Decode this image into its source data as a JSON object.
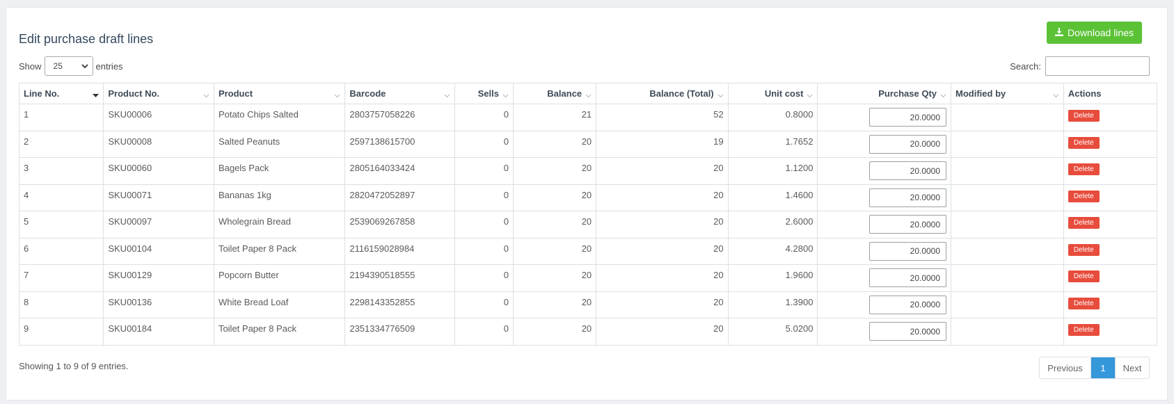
{
  "title": "Edit purchase draft lines",
  "download_button": "Download lines",
  "show_label": "Show",
  "entries_value": "25",
  "entries_label": "entries",
  "search_label": "Search:",
  "search_value": "",
  "columns": [
    "Line No.",
    "Product No.",
    "Product",
    "Barcode",
    "Sells",
    "Balance",
    "Balance (Total)",
    "Unit cost",
    "Purchase Qty",
    "Modified by",
    "Actions"
  ],
  "rows": [
    {
      "line": "1",
      "sku": "SKU00006",
      "product": "Potato Chips Salted",
      "barcode": "2803757058226",
      "sells": "0",
      "balance": "21",
      "balance_total": "52",
      "unit_cost": "0.8000",
      "qty": "20.0000",
      "modified_by": "",
      "action": "Delete"
    },
    {
      "line": "2",
      "sku": "SKU00008",
      "product": "Salted Peanuts",
      "barcode": "2597138615700",
      "sells": "0",
      "balance": "20",
      "balance_total": "19",
      "unit_cost": "1.7652",
      "qty": "20.0000",
      "modified_by": "",
      "action": "Delete"
    },
    {
      "line": "3",
      "sku": "SKU00060",
      "product": "Bagels Pack",
      "barcode": "2805164033424",
      "sells": "0",
      "balance": "20",
      "balance_total": "20",
      "unit_cost": "1.1200",
      "qty": "20.0000",
      "modified_by": "",
      "action": "Delete"
    },
    {
      "line": "4",
      "sku": "SKU00071",
      "product": "Bananas 1kg",
      "barcode": "2820472052897",
      "sells": "0",
      "balance": "20",
      "balance_total": "20",
      "unit_cost": "1.4600",
      "qty": "20.0000",
      "modified_by": "",
      "action": "Delete"
    },
    {
      "line": "5",
      "sku": "SKU00097",
      "product": "Wholegrain Bread",
      "barcode": "2539069267858",
      "sells": "0",
      "balance": "20",
      "balance_total": "20",
      "unit_cost": "2.6000",
      "qty": "20.0000",
      "modified_by": "",
      "action": "Delete"
    },
    {
      "line": "6",
      "sku": "SKU00104",
      "product": "Toilet Paper 8 Pack",
      "barcode": "2116159028984",
      "sells": "0",
      "balance": "20",
      "balance_total": "20",
      "unit_cost": "4.2800",
      "qty": "20.0000",
      "modified_by": "",
      "action": "Delete"
    },
    {
      "line": "7",
      "sku": "SKU00129",
      "product": "Popcorn Butter",
      "barcode": "2194390518555",
      "sells": "0",
      "balance": "20",
      "balance_total": "20",
      "unit_cost": "1.9600",
      "qty": "20.0000",
      "modified_by": "",
      "action": "Delete"
    },
    {
      "line": "8",
      "sku": "SKU00136",
      "product": "White Bread Loaf",
      "barcode": "2298143352855",
      "sells": "0",
      "balance": "20",
      "balance_total": "20",
      "unit_cost": "1.3900",
      "qty": "20.0000",
      "modified_by": "",
      "action": "Delete"
    },
    {
      "line": "9",
      "sku": "SKU00184",
      "product": "Toilet Paper 8 Pack",
      "barcode": "2351334776509",
      "sells": "0",
      "balance": "20",
      "balance_total": "20",
      "unit_cost": "5.0200",
      "qty": "20.0000",
      "modified_by": "",
      "action": "Delete"
    }
  ],
  "footer_info": "Showing 1 to 9 of 9 entries.",
  "pager": {
    "prev": "Previous",
    "page": "1",
    "next": "Next"
  },
  "colors": {
    "download": "#5bc236",
    "delete": "#e74c3c",
    "active_page": "#3498db"
  }
}
